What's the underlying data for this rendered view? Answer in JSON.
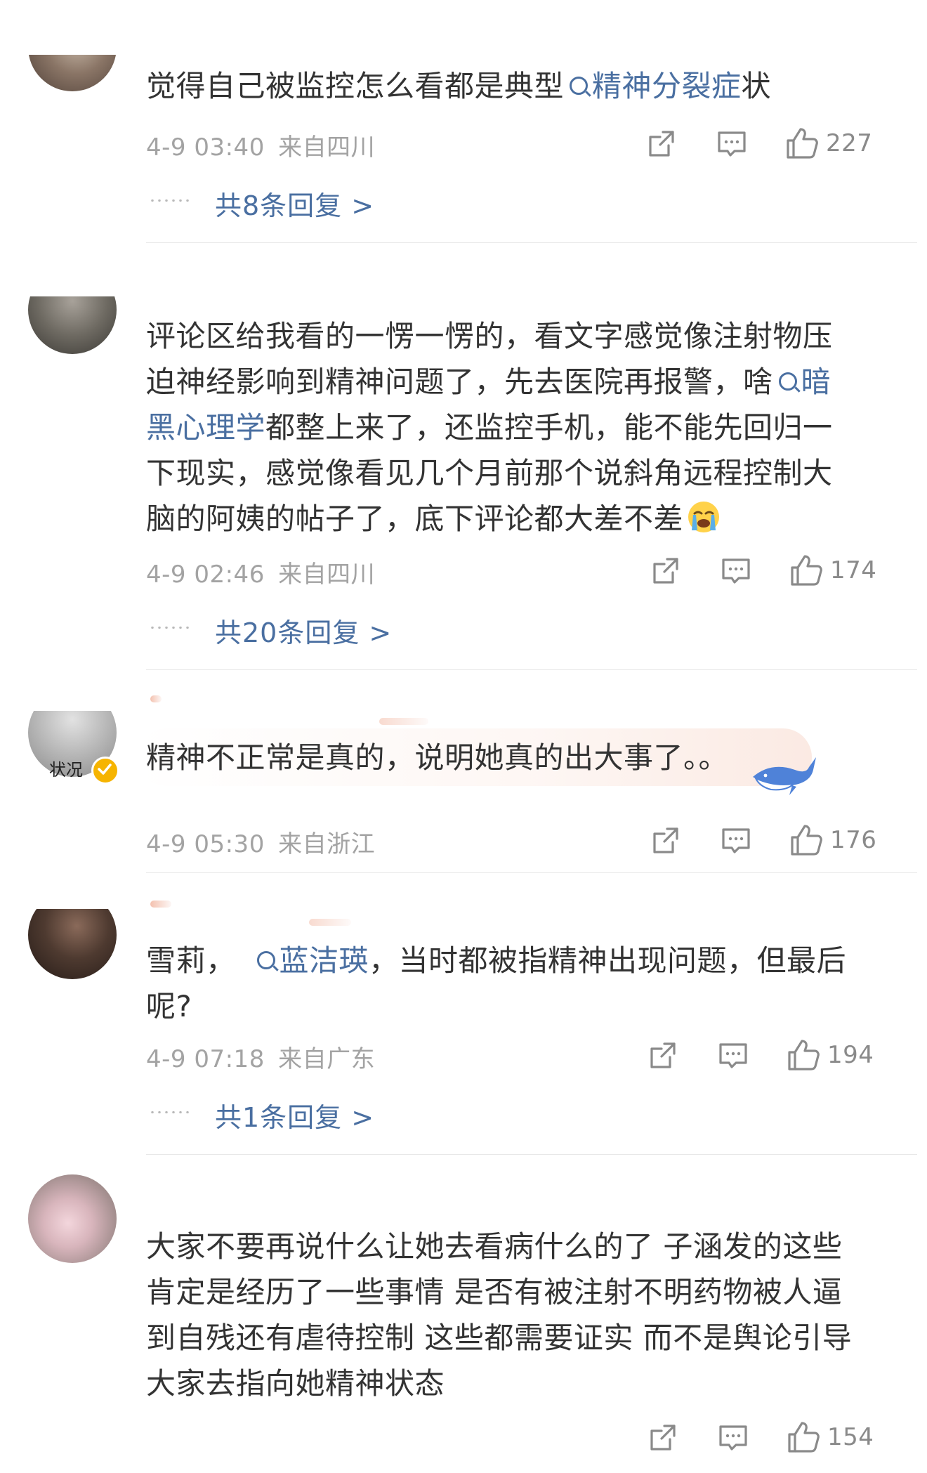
{
  "comments": [
    {
      "text_parts": [
        "觉得自己被监控怎么看都是典型",
        "精神分裂症",
        "状"
      ],
      "time": "4-9 03:40",
      "location": "来自四川",
      "likes": "227",
      "replies": "共8条回复 >"
    },
    {
      "line1": "评论区给我看的一愣一愣的，看文字感觉像注射物压",
      "line2_text": "迫神经影响到精神问题了，先去医院再报警，啥",
      "line2_tag": "暗",
      "line3_tag": "黑心理学",
      "line3_text": "都整上来了，还监控手机，能不能先回归一",
      "line4": "下现实，感觉像看见几个月前那个说斜角远程控制大",
      "line5": "脑的阿姨的帖子了，底下评论都大差不差",
      "time": "4-9 02:46",
      "location": "来自四川",
      "likes": "174",
      "replies": "共20条回复 >"
    },
    {
      "text": "精神不正常是真的，说明她真的出大事了。。",
      "avatar_caption": "状况",
      "time": "4-9 05:30",
      "location": "来自浙江",
      "likes": "176"
    },
    {
      "text_start": "雪莉，",
      "tag": "蓝洁瑛",
      "text_end": "，当时都被指精神出现问题，但最后",
      "line2": "呢?",
      "time": "4-9 07:18",
      "location": "来自广东",
      "likes": "194",
      "replies": "共1条回复 >"
    },
    {
      "line1": "大家不要再说什么让她去看病什么的了 子涵发的这些",
      "line2": "肯定是经历了一些事情 是否有被注射不明药物被人逼",
      "line3": "到自残还有虐待控制 这些都需要证实 而不是舆论引导",
      "line4": "大家去指向她精神状态",
      "likes": "154"
    }
  ],
  "icons": {
    "share": "share-icon",
    "comment": "comment-icon",
    "like": "thumbs-up-icon",
    "emoji": "crying-emoji-icon",
    "sticker": "whale-sticker",
    "verified": "verified-badge-icon",
    "search": "search-icon"
  },
  "colors": {
    "text": "#333333",
    "meta": "#a3a3a3",
    "link": "#4a6fa1",
    "verified": "#f6b400"
  }
}
